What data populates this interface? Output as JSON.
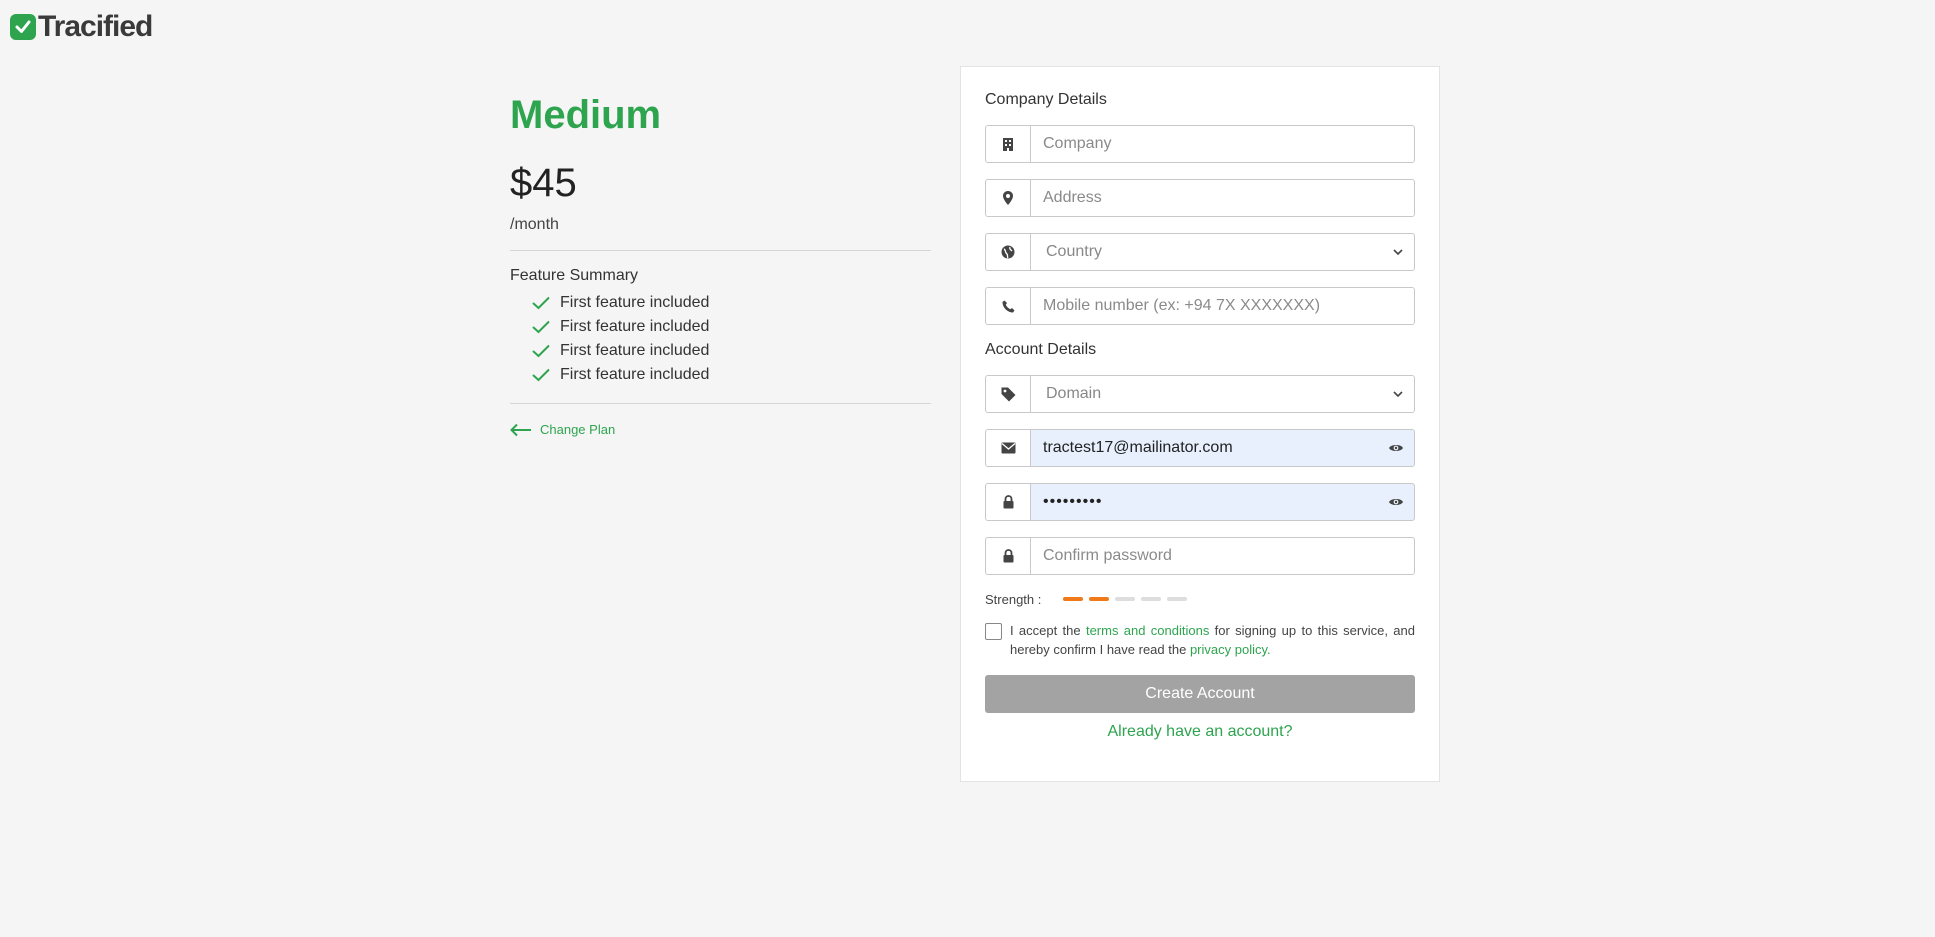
{
  "brand": {
    "name": "Tracified",
    "color": "#2ea44f"
  },
  "plan": {
    "name": "Medium",
    "price": "$45",
    "period": "/month",
    "feature_title": "Feature Summary",
    "features": [
      "First feature included",
      "First feature included",
      "First feature included",
      "First feature included"
    ],
    "change_plan": "Change Plan"
  },
  "form": {
    "company_section": "Company Details",
    "company_placeholder": "Company",
    "address_placeholder": "Address",
    "country_selected": "Country",
    "mobile_placeholder": "Mobile number (ex: +94 7X XXXXXXX)",
    "account_section": "Account Details",
    "domain_selected": "Domain",
    "email_value": "tractest17@mailinator.com",
    "password_value": "•••••••••",
    "confirm_placeholder": "Confirm password",
    "strength_label": "Strength :",
    "strength_level": 2,
    "strength_max": 5,
    "terms_prefix": "I accept the",
    "terms_link": "terms and conditions",
    "terms_middle": "for signing up to this service, and hereby confirm I have read the",
    "privacy_link": "privacy policy.",
    "create_button": "Create Account",
    "signin_link": "Already have an account?"
  },
  "icons": [
    "building-icon",
    "map-pin-icon",
    "globe-icon",
    "phone-icon",
    "tag-icon",
    "envelope-icon",
    "lock-icon",
    "eye-icon",
    "check-icon",
    "arrow-left-icon",
    "chevron-down-icon"
  ],
  "colors": {
    "accent": "#2ea44f",
    "strength_on": "#f07a1a",
    "button_disabled": "#a3a3a3",
    "autofill_bg": "#e8f0fe"
  }
}
